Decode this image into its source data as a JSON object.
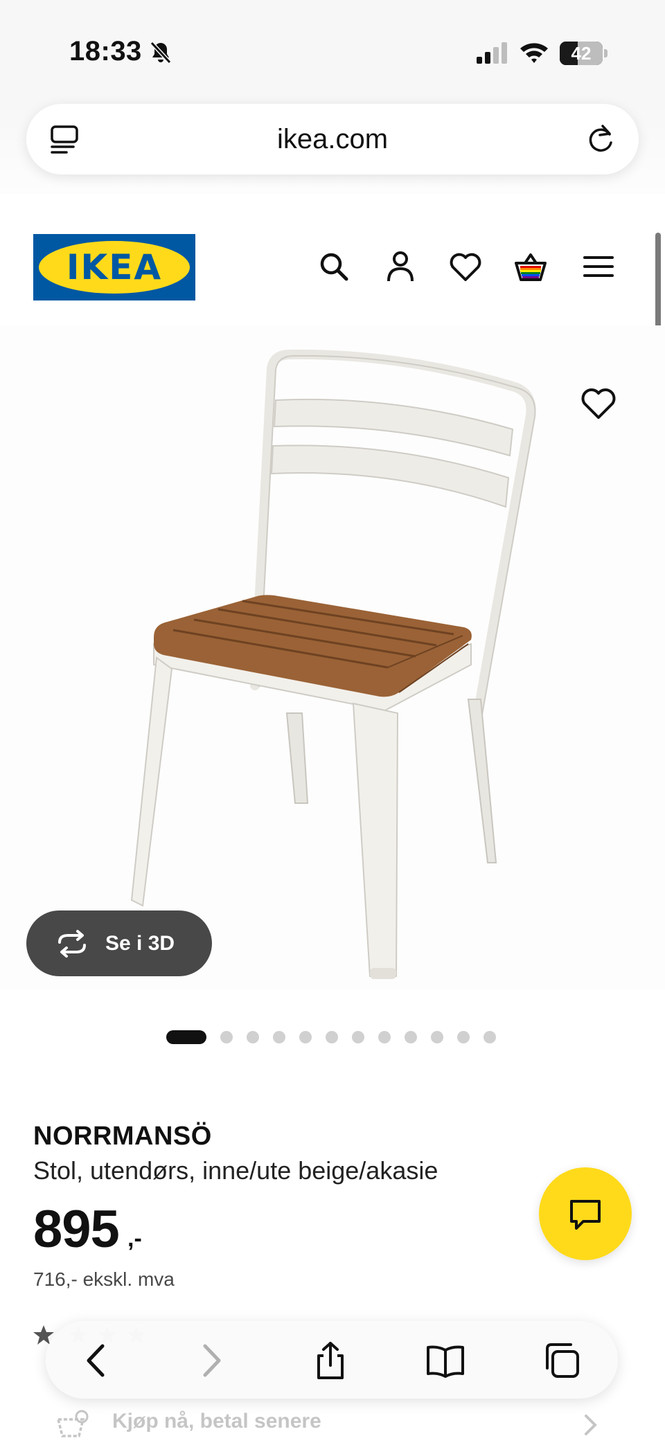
{
  "status_bar": {
    "time": "18:33",
    "battery": "42",
    "battery_level": 0.42,
    "icons": [
      "bell-slash-icon",
      "cellular-signal-icon",
      "wifi-icon",
      "battery-icon"
    ]
  },
  "browser": {
    "url": "ikea.com",
    "icons": [
      "reader-mode-icon",
      "reload-icon"
    ]
  },
  "header": {
    "logo_text": "IKEA",
    "logo_colors": {
      "blue": "#0058a3",
      "yellow": "#ffda1a"
    },
    "nav_icons": [
      "search-icon",
      "account-icon",
      "wishlist-heart-icon",
      "shopping-basket-icon",
      "menu-icon"
    ]
  },
  "gallery": {
    "view_3d_label": "Se i 3D",
    "image_count": 12,
    "active_index": 0
  },
  "product": {
    "name": "NORRMANSÖ",
    "description": "Stol, utendørs, inne/ute beige/akasie",
    "price": "895",
    "price_suffix": ",-",
    "price_ex_vat": "716,- ekskl. mva",
    "rating_star_icon": "star-icon"
  },
  "chat": {
    "icon": "chat-bubble-icon",
    "color": "#ffda1a"
  },
  "toolbar": {
    "icons": [
      "back-icon",
      "forward-icon",
      "share-icon",
      "bookmarks-icon",
      "tabs-icon"
    ]
  },
  "bnpl": {
    "label": "Kjøp nå, betal senere"
  }
}
